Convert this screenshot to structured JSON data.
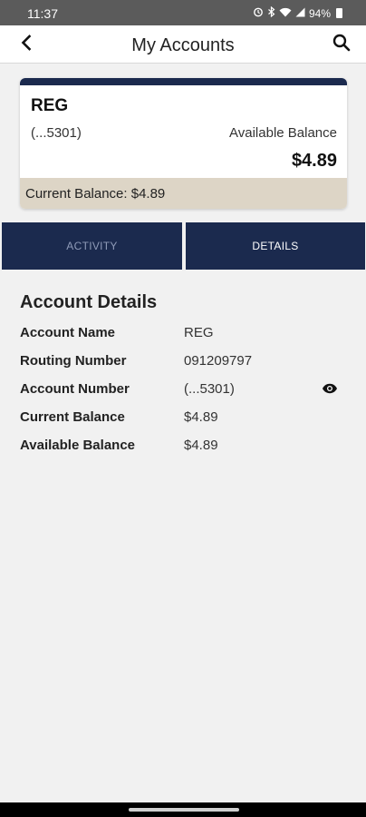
{
  "status_bar": {
    "time": "11:37",
    "battery_text": "94%",
    "icons": [
      "alarm-icon",
      "bluetooth-icon",
      "wifi-icon",
      "signal-icon",
      "battery-icon"
    ]
  },
  "header": {
    "title": "My Accounts",
    "back_icon": "chevron-left-icon",
    "search_icon": "search-icon"
  },
  "account_card": {
    "name": "REG",
    "account_mask": "(...5301)",
    "available_label": "Available Balance",
    "available_value": "$4.89",
    "current_balance_text": "Current Balance: $4.89",
    "accent_color": "#1b2a4e",
    "footer_color": "#ddd5c6"
  },
  "tabs": [
    {
      "label": "ACTIVITY",
      "selected": false
    },
    {
      "label": "DETAILS",
      "selected": true
    }
  ],
  "details": {
    "title": "Account Details",
    "rows": [
      {
        "label": "Account Name",
        "value": "REG"
      },
      {
        "label": "Routing Number",
        "value": "091209797"
      },
      {
        "label": "Account Number",
        "value": "(...5301)",
        "icon": "eye-icon"
      },
      {
        "label": "Current Balance",
        "value": "$4.89"
      },
      {
        "label": "Available Balance",
        "value": "$4.89"
      }
    ]
  },
  "colors": {
    "navy": "#1b2a4e",
    "background": "#f1f1f1",
    "status_bar": "#5b5b5b"
  }
}
